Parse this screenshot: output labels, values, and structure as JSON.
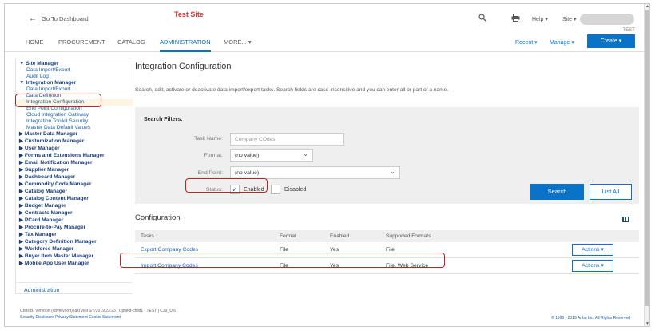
{
  "header": {
    "back_label": "Go To Dashboard",
    "site_label": "Test Site",
    "help_label": "Help ▾",
    "site_menu_label": "Site ▾",
    "tag": "- TEST",
    "nav_tabs": [
      "HOME",
      "PROCUREMENT",
      "CATALOG",
      "ADMINISTRATION",
      "MORE... ▾"
    ],
    "active_tab": "ADMINISTRATION",
    "recent_label": "Recent ▾",
    "manage_label": "Manage ▾",
    "create_label": "Create ▾"
  },
  "sidebar": {
    "items": [
      {
        "label": "▼ Site Manager",
        "type": "header"
      },
      {
        "label": "Data Import/Export",
        "type": "sub"
      },
      {
        "label": "Audit Log",
        "type": "sub"
      },
      {
        "label": "▼ Integration Manager",
        "type": "header"
      },
      {
        "label": "Data Import/Export",
        "type": "sub"
      },
      {
        "label": "Data Definition",
        "type": "sub"
      },
      {
        "label": "Integration Configuration",
        "type": "selected"
      },
      {
        "label": "End Point Configuration",
        "type": "sub"
      },
      {
        "label": "Cloud Integration Gateway",
        "type": "sub"
      },
      {
        "label": "Integration Toolkit Security",
        "type": "sub"
      },
      {
        "label": "Master Data Default Values",
        "type": "sub"
      },
      {
        "label": "▶ Master Data Manager",
        "type": "header"
      },
      {
        "label": "▶ Customization Manager",
        "type": "header"
      },
      {
        "label": "▶ User Manager",
        "type": "header"
      },
      {
        "label": "▶ Forms and Extensions Manager",
        "type": "header"
      },
      {
        "label": "▶ Email Notification Manager",
        "type": "header"
      },
      {
        "label": "▶ Supplier Manager",
        "type": "header"
      },
      {
        "label": "▶ Dashboard Manager",
        "type": "header"
      },
      {
        "label": "▶ Commodity Code Manager",
        "type": "header"
      },
      {
        "label": "▶ Catalog Manager",
        "type": "header"
      },
      {
        "label": "▶ Catalog Content Manager",
        "type": "header"
      },
      {
        "label": "▶ Budget Manager",
        "type": "header"
      },
      {
        "label": "▶ Contracts Manager",
        "type": "header"
      },
      {
        "label": "▶ PCard Manager",
        "type": "header"
      },
      {
        "label": "▶ Procure-to-Pay Manager",
        "type": "header"
      },
      {
        "label": "▶ Tax Manager",
        "type": "header"
      },
      {
        "label": "▶ Category Definition Manager",
        "type": "header"
      },
      {
        "label": "▶ Workforce Manager",
        "type": "header"
      },
      {
        "label": "▶ Buyer Item Master Manager",
        "type": "header"
      },
      {
        "label": "▶ Mobile App User Manager",
        "type": "header"
      }
    ],
    "footer_link": "Administration"
  },
  "main": {
    "title": "Integration Configuration",
    "description": "Search, edit, activate or deactivate data import/export tasks. Search fields are case-insensitive and you can enter all or part of a name.",
    "filters": {
      "heading": "Search Filters:",
      "task_name_label": "Task Name:",
      "task_name_value": "Company COdes",
      "format_label": "Format:",
      "format_value": "(no value)",
      "endpoint_label": "End Point:",
      "endpoint_value": "(no value)",
      "status_label": "Status:",
      "enabled_label": "Enabled",
      "disabled_label": "Disabled",
      "search_label": "Search",
      "list_all_label": "List All"
    },
    "configuration": {
      "title": "Configuration",
      "columns": [
        "Tasks ↑",
        "Format",
        "Enabled",
        "Supported Formats"
      ],
      "rows": [
        {
          "task": "Export Company Codes",
          "format": "File",
          "enabled": "Yes",
          "supported": "File",
          "action": "Actions ▾"
        },
        {
          "task": "Import Company Codes",
          "format": "File",
          "enabled": "Yes",
          "supported": "File, Web Service",
          "action": "Actions ▾"
        }
      ]
    }
  },
  "footer": {
    "login_info": "Chris B. Vervoort (cbvervoort) last visit 6/7/2019 23:23 | Upfield-child1 - TEST | C39_UI6",
    "links": "Security Disclosure Privacy Statement Cookie Statement",
    "copyright": "© 1996 - 2019 Ariba Inc. All Rights Reserved"
  },
  "colors": {
    "accent": "#0a73c8",
    "annotation": "#c0211f",
    "site_label": "#e0302e"
  }
}
